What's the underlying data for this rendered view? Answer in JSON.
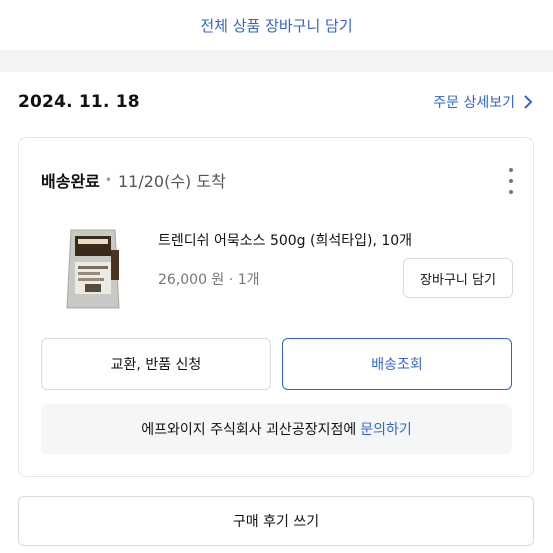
{
  "top_link": "전체 상품 장바구니 담기",
  "order": {
    "date": "2024. 11. 18",
    "detail_link": "주문 상세보기",
    "status": "배송완료",
    "arrival": "11/20(수) 도착",
    "product": {
      "name": "트렌디쉬 어묵소스 500g (희석타입), 10개",
      "price": "26,000 원",
      "quantity": "1개",
      "cart_button": "장바구니 담기"
    },
    "actions": {
      "exchange": "교환, 반품 신청",
      "track": "배송조회"
    },
    "inquiry": {
      "prefix": "에프와이지 주식회사 괴산공장지점에",
      "link": "문의하기"
    },
    "review_button": "구매 후기 쓰기"
  },
  "colors": {
    "accent": "#3366cc",
    "background": "#f2f3f5"
  }
}
